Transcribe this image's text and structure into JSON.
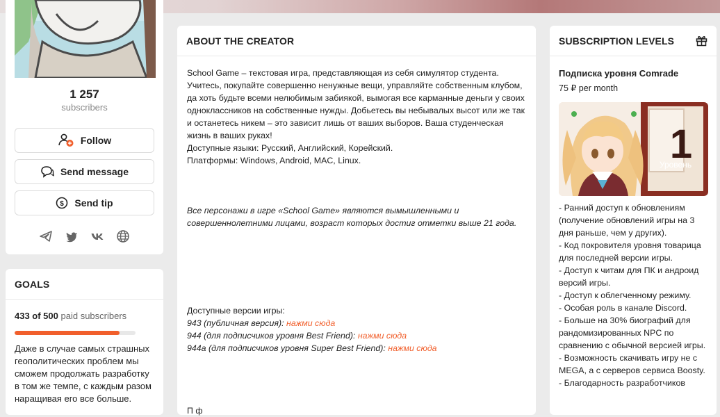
{
  "profile": {
    "subscriber_count": "1 257",
    "subscriber_label": "subscribers",
    "follow_label": "Follow",
    "message_label": "Send message",
    "tip_label": "Send tip",
    "social_icons": [
      "telegram-icon",
      "twitter-icon",
      "vk-icon",
      "globe-icon"
    ]
  },
  "goals": {
    "title": "GOALS",
    "current": "433 of 500",
    "unit": "paid subscribers",
    "progress_fraction": 0.866,
    "description": "Даже в случае самых страшных геополитических проблем мы сможем продолжать разработку в том же темпе, с каждым разом наращивая его все больше."
  },
  "about": {
    "title": "ABOUT THE CREATOR",
    "p1": "School Game – текстовая игра, представляющая из себя симулятор студента. Учитесь, покупайте совершенно ненужные вещи, управляйте собственным клубом, да хоть будьте всеми нелюбимым забиякой, вымогая все карманные деньги у своих одноклассников на собственные нужды. Добьетесь вы небывалых высот или же так и останетесь никем – это зависит лишь от ваших выборов. Ваша студенческая жизнь в ваших руках!",
    "languages": "Доступные языки: Русский, Английский, Корейский.",
    "platforms": "Платформы: Windows, Android, MAC, Linux.",
    "disclaimer": "Все персонажи в игре «School Game» являются вымышленными и совершеннолетними лицами, возраст которых достиг отметки выше 21 года.",
    "versions_title": "Доступные версии игры:",
    "versions": [
      {
        "label": "943 (публичная версия):",
        "link": "нажми сюда"
      },
      {
        "label": "944 (для подписчиков уровня Best Friend):",
        "link": "нажми сюда"
      },
      {
        "label": "944a (для подписчиков уровня Super Best Friend):",
        "link": "нажми сюда"
      }
    ],
    "cut_text": "П                   ф"
  },
  "subscription": {
    "title": "SUBSCRIPTION LEVELS",
    "tier_name": "Подписка уровня Comrade",
    "tier_price": "75 ₽ per month",
    "badge_number": "1",
    "badge_text": "Уровень",
    "perks": [
      "- Ранний доступ к обновлениям (получение обновлений игры на 3 дня раньше, чем у других).",
      "- Код покровителя уровня товарица для последней версии игры.",
      "- Доступ к читам для ПК и андроид версий игры.",
      "- Доступ к облегченному режиму.",
      "- Особая роль в канале Discord.",
      "- Больше на 30% биографий для рандомизированных NPC по сравнению с обычной версией игры.",
      "- Возможность скачивать игру не с MEGA, а с серверов сервиса Boosty.",
      "- Благодарность разработчиков"
    ]
  },
  "colors": {
    "accent": "#f15f2c",
    "background": "#ebebeb"
  }
}
